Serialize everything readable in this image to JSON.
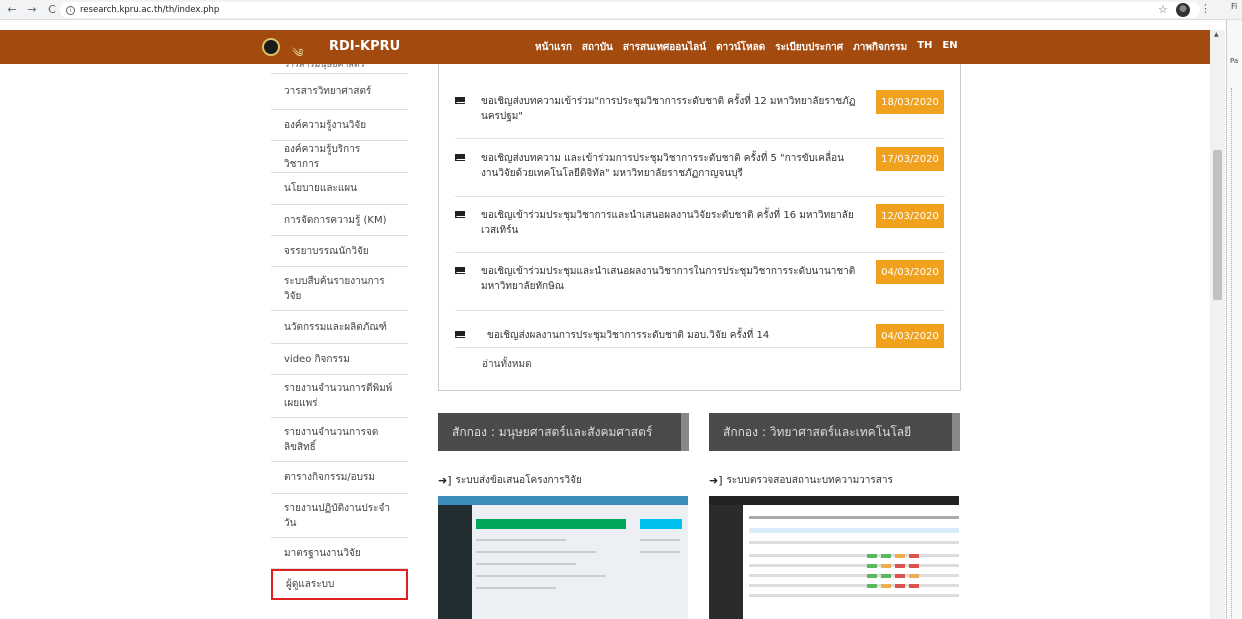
{
  "browser": {
    "url": "research.kpru.ac.th/th/index.php",
    "side_letter": "Fi",
    "side_panel_label": "Pa"
  },
  "header": {
    "brand": "RDI-KPRU",
    "nav": [
      "หน้าแรก",
      "สถาบัน",
      "สารสนเทศออนไลน์",
      "ดาวน์โหลด",
      "ระเบียบประกาศ",
      "ภาพกิจกรรม",
      "TH",
      "EN"
    ]
  },
  "sidebar": {
    "items": [
      "วารสารมนุษยศาสตร์",
      "วารสารวิทยาศาสตร์",
      "องค์ความรู้งานวิจัย",
      "องค์ความรู้บริการวิชาการ",
      "นโยบายและแผน",
      "การจัดการความรู้ (KM)",
      "จรรยาบรรณนักวิจัย",
      "ระบบสืบค้นรายงานการวิจัย",
      "นวัตกรรมและผลิตภัณฑ์",
      "video กิจกรรม",
      "รายงานจำนวนการตีพิมพ์เผยแพร่",
      "รายงานจำนวนการจดลิขสิทธิ์",
      "ตารางกิจกรรม/อบรม",
      "รายงานปฏิบัติงานประจำวัน",
      "มาตรฐานงานวิจัย",
      "ผู้ดูแลระบบ"
    ]
  },
  "news": {
    "items": [
      {
        "text": "ขอเชิญส่งบทความเข้าร่วม\"การประชุมวิชาการระดับชาติ ครั้งที่ 12 มหาวิทยาลัยราชภัฏนครปฐม\"",
        "date": "18/03/2020"
      },
      {
        "text": "ขอเชิญส่งบทความ และเข้าร่วมการประชุมวิชาการระดับชาติ ครั้งที่ 5 \"การขับเคลื่อนงานวิจัยด้วยเทคโนโลยีดิจิทัล\" มหาวิทยาลัยราชภัฏกาญจนบุรี",
        "date": "17/03/2020"
      },
      {
        "text": "ขอเชิญเข้าร่วมประชุมวิชาการและนำเสนอผลงานวิจัยระดับชาติ ครั้งที่ 16 มหาวิทยาลัยเวสเทิร์น",
        "date": "12/03/2020"
      },
      {
        "text": "ขอเชิญเข้าร่วมประชุมและนำเสนอผลงานวิชาการในการประชุมวิชาการระดับนานาชาติ มหาวิทยาลัยทักษิณ",
        "date": "04/03/2020"
      },
      {
        "text": "ขอเชิญส่งผลงานการประชุมวิชาการระดับชาติ มอบ.วิจัย ครั้งที่ 14",
        "date": "04/03/2020"
      }
    ],
    "read_all": "อ่านทั้งหมด"
  },
  "clusters": {
    "left": {
      "label": "สักกอง",
      "title": "มนุษยศาสตร์และสังคมศาสตร์"
    },
    "right": {
      "label": "สักกอง",
      "title": "วิทยาศาสตร์และเทคโนโลยี"
    }
  },
  "sections": {
    "left_title": "ระบบส่งข้อเสนอโครงการวิจัย",
    "right_title": "ระบบตรวจสอบสถานะบทความวารสาร"
  },
  "colors": {
    "header": "#a34a0f",
    "date_badge": "#f0a11e",
    "highlight": "#e02020"
  }
}
